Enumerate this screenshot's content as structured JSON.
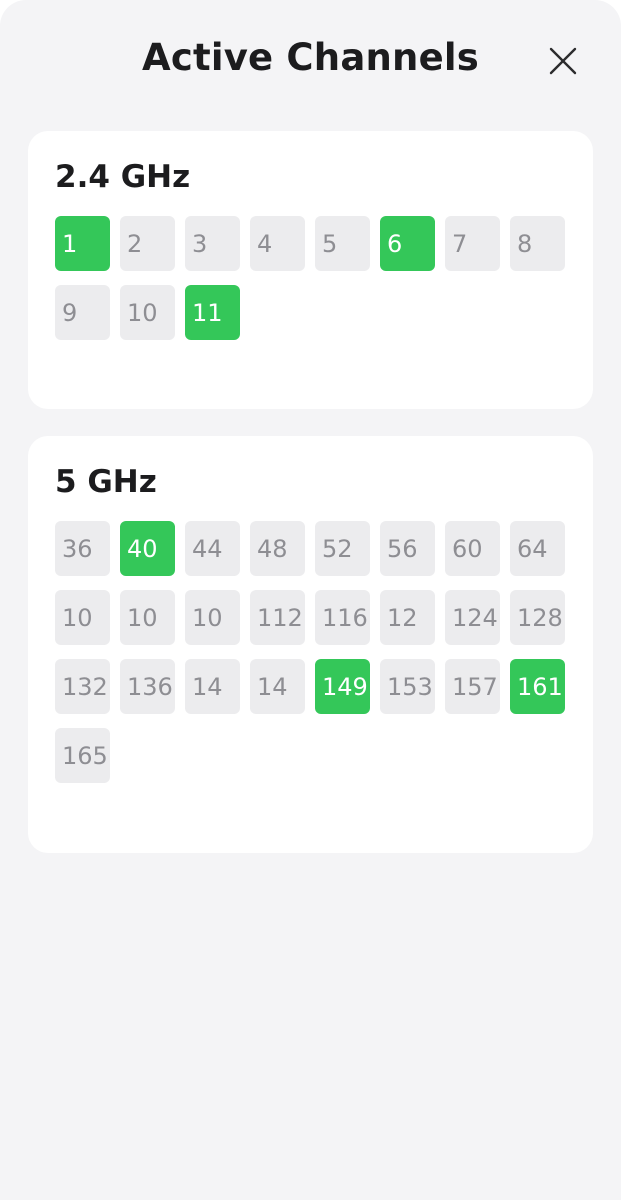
{
  "header": {
    "title": "Active Channels",
    "close_icon": "close-icon"
  },
  "colors": {
    "active": "#34c759",
    "inactive": "#ececee",
    "background": "#f4f4f6"
  },
  "bands": [
    {
      "title": "2.4 GHz",
      "channels": [
        {
          "label": "1",
          "active": true
        },
        {
          "label": "2",
          "active": false
        },
        {
          "label": "3",
          "active": false
        },
        {
          "label": "4",
          "active": false
        },
        {
          "label": "5",
          "active": false
        },
        {
          "label": "6",
          "active": true
        },
        {
          "label": "7",
          "active": false
        },
        {
          "label": "8",
          "active": false
        },
        {
          "label": "9",
          "active": false
        },
        {
          "label": "10",
          "active": false
        },
        {
          "label": "11",
          "active": true
        }
      ]
    },
    {
      "title": "5 GHz",
      "channels": [
        {
          "label": "36",
          "active": false
        },
        {
          "label": "40",
          "active": true
        },
        {
          "label": "44",
          "active": false
        },
        {
          "label": "48",
          "active": false
        },
        {
          "label": "52",
          "active": false
        },
        {
          "label": "56",
          "active": false
        },
        {
          "label": "60",
          "active": false
        },
        {
          "label": "64",
          "active": false
        },
        {
          "label": "10",
          "active": false
        },
        {
          "label": "10",
          "active": false
        },
        {
          "label": "10",
          "active": false
        },
        {
          "label": "112",
          "active": false
        },
        {
          "label": "116",
          "active": false
        },
        {
          "label": "12",
          "active": false
        },
        {
          "label": "124",
          "active": false
        },
        {
          "label": "128",
          "active": false
        },
        {
          "label": "132",
          "active": false
        },
        {
          "label": "136",
          "active": false
        },
        {
          "label": "14",
          "active": false
        },
        {
          "label": "14",
          "active": false
        },
        {
          "label": "149",
          "active": true
        },
        {
          "label": "153",
          "active": false
        },
        {
          "label": "157",
          "active": false
        },
        {
          "label": "161",
          "active": true
        },
        {
          "label": "165",
          "active": false
        }
      ]
    }
  ]
}
